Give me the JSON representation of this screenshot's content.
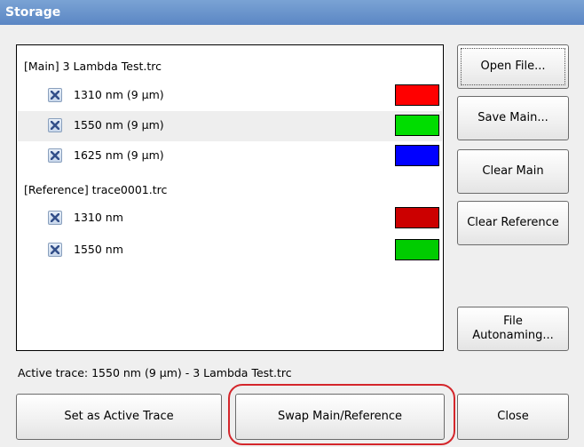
{
  "window": {
    "title": "Storage"
  },
  "main_group": {
    "header": "[Main] 3 Lambda Test.trc",
    "traces": [
      {
        "label": "1310 nm (9 µm)",
        "checked": true,
        "color": "#ff0000",
        "active": false
      },
      {
        "label": "1550 nm (9 µm)",
        "checked": true,
        "color": "#00dd00",
        "active": true
      },
      {
        "label": "1625 nm (9 µm)",
        "checked": true,
        "color": "#0000ff",
        "active": false
      }
    ]
  },
  "reference_group": {
    "header": "[Reference] trace0001.trc",
    "traces": [
      {
        "label": "1310 nm",
        "checked": true,
        "color": "#cc0000"
      },
      {
        "label": "1550 nm",
        "checked": true,
        "color": "#00cc00"
      }
    ]
  },
  "side_buttons": {
    "open_file": "Open File...",
    "save_main": "Save Main...",
    "clear_main": "Clear Main",
    "clear_reference": "Clear Reference",
    "file_autonaming": "File\nAutonaming..."
  },
  "status": {
    "active_trace": "Active trace: 1550 nm (9 µm) - 3 Lambda Test.trc"
  },
  "bottom_buttons": {
    "set_active": "Set as Active Trace",
    "swap": "Swap Main/Reference",
    "close": "Close"
  },
  "highlight_color": "#d4262b"
}
